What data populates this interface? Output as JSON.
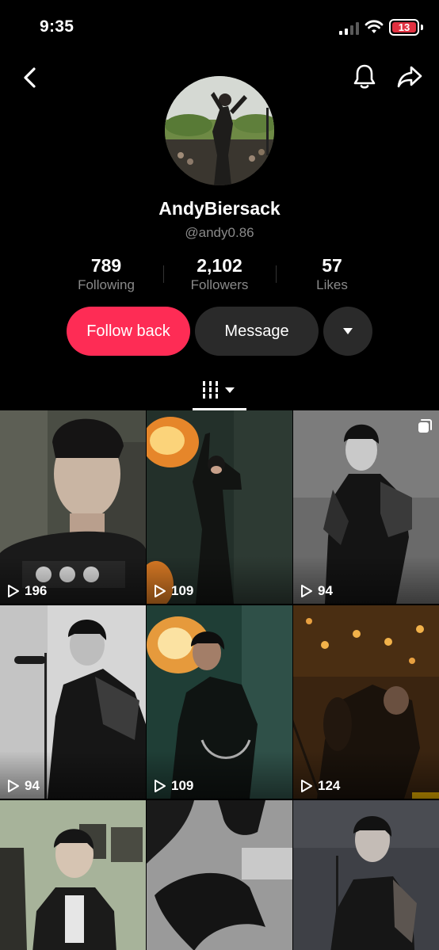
{
  "status_bar": {
    "time": "9:35",
    "battery_level": "13"
  },
  "profile": {
    "username": "AndyBiersack",
    "handle": "@andy0.86",
    "stats": [
      {
        "value": "789",
        "label": "Following"
      },
      {
        "value": "2,102",
        "label": "Followers"
      },
      {
        "value": "57",
        "label": "Likes"
      }
    ]
  },
  "actions": {
    "follow_back_label": "Follow back",
    "message_label": "Message"
  },
  "videos": [
    {
      "views": "196",
      "icon": "play-icon"
    },
    {
      "views": "109",
      "icon": "play-icon"
    },
    {
      "views": "94",
      "icon": "play-icon",
      "multi_image": true
    },
    {
      "views": "94",
      "icon": "play-icon"
    },
    {
      "views": "109",
      "icon": "play-icon"
    },
    {
      "views": "124",
      "icon": "play-icon"
    },
    {
      "views": "",
      "icon": "play-icon"
    },
    {
      "views": "",
      "icon": "play-icon"
    },
    {
      "views": "",
      "icon": "play-icon"
    }
  ],
  "colors": {
    "accent": "#fe2c55",
    "button_dark": "#2a2a2a",
    "muted_text": "#8a8a8a"
  }
}
